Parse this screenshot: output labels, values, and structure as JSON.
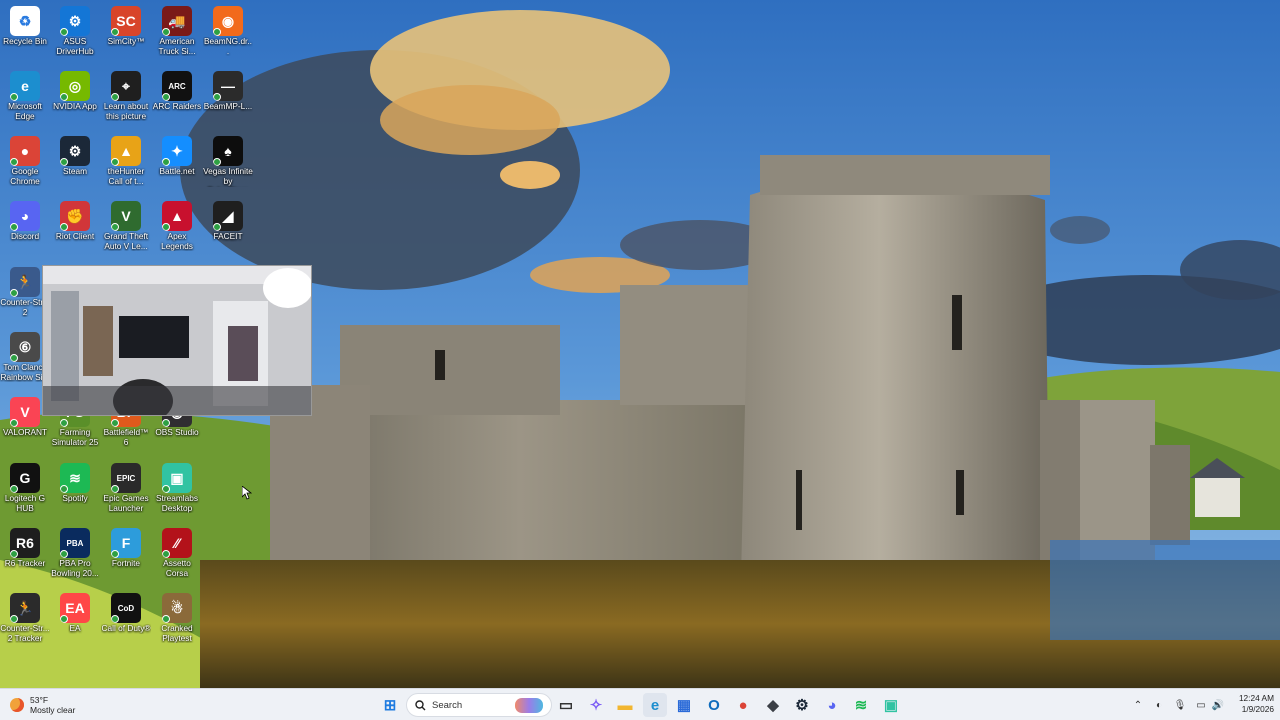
{
  "desktop": {
    "icons": [
      {
        "label": "Recycle Bin",
        "icon": "recycle-bin-icon",
        "color": "#ffffff",
        "glyph": "♻"
      },
      {
        "label": "ASUS DriverHub",
        "icon": "asus-driverhub-icon",
        "color": "#1476d6",
        "glyph": "⚙"
      },
      {
        "label": "SimCity™",
        "icon": "simcity-icon",
        "color": "#d8452a",
        "glyph": "SC"
      },
      {
        "label": "American Truck Si...",
        "icon": "american-truck-simulator-icon",
        "color": "#7a1a18",
        "glyph": "🚚"
      },
      {
        "label": "BeamNG.dr...",
        "icon": "beamng-icon",
        "color": "#f26a1b",
        "glyph": "◉"
      },
      {
        "label": "Microsoft Edge",
        "icon": "microsoft-edge-icon",
        "color": "#1c8ecf",
        "glyph": "e"
      },
      {
        "label": "NVIDIA App",
        "icon": "nvidia-app-icon",
        "color": "#76b900",
        "glyph": "◎"
      },
      {
        "label": "Learn about this picture",
        "icon": "learn-about-picture-icon",
        "color": "#1f1f1f",
        "glyph": "⌖"
      },
      {
        "label": "ARC Raiders",
        "icon": "arc-raiders-icon",
        "color": "#111111",
        "glyph": "ARC"
      },
      {
        "label": "BeamMP-L...",
        "icon": "beammp-launcher-icon",
        "color": "#2b2b2b",
        "glyph": "—"
      },
      {
        "label": "Google Chrome",
        "icon": "google-chrome-icon",
        "color": "#db4437",
        "glyph": "●"
      },
      {
        "label": "Steam",
        "icon": "steam-icon",
        "color": "#1b2838",
        "glyph": "⚙"
      },
      {
        "label": "theHunter Call of t...",
        "icon": "thehunter-icon",
        "color": "#e8a317",
        "glyph": "▲"
      },
      {
        "label": "Battle.net",
        "icon": "battle-net-icon",
        "color": "#148eff",
        "glyph": "✦"
      },
      {
        "label": "Vegas Infinite by PokerStars",
        "icon": "vegas-infinite-icon",
        "color": "#0d0d0d",
        "glyph": "♠"
      },
      {
        "label": "Discord",
        "icon": "discord-icon",
        "color": "#5865f2",
        "glyph": "◕"
      },
      {
        "label": "Riot Client",
        "icon": "riot-client-icon",
        "color": "#d13639",
        "glyph": "✊"
      },
      {
        "label": "Grand Theft Auto V Le...",
        "icon": "gta-v-icon",
        "color": "#2f6b2f",
        "glyph": "V"
      },
      {
        "label": "Apex Legends",
        "icon": "apex-legends-icon",
        "color": "#c8102e",
        "glyph": "▲"
      },
      {
        "label": "FACEIT",
        "icon": "faceit-icon",
        "color": "#1f1f1f",
        "glyph": "◢"
      },
      {
        "label": "Counter-Str... 2",
        "icon": "counter-strike-2-icon",
        "color": "#3a5a8c",
        "glyph": "🏃"
      },
      {
        "label": "Tom Clancy Rainbow Si...",
        "icon": "rainbow-six-siege-icon",
        "color": "#4a4a4a",
        "glyph": "⑥"
      },
      {
        "label": "VALORANT",
        "icon": "valorant-icon",
        "color": "#fa4454",
        "glyph": "V"
      },
      {
        "label": "Farming Simulator 25",
        "icon": "farming-simulator-icon",
        "color": "#5a8f29",
        "glyph": "FS"
      },
      {
        "label": "Battlefield™ 6",
        "icon": "battlefield-6-icon",
        "color": "#e05a1c",
        "glyph": "BF"
      },
      {
        "label": "OBS Studio",
        "icon": "obs-studio-icon",
        "color": "#302e31",
        "glyph": "◉"
      },
      {
        "label": "Logitech G HUB",
        "icon": "logitech-g-hub-icon",
        "color": "#111111",
        "glyph": "G"
      },
      {
        "label": "Spotify",
        "icon": "spotify-icon",
        "color": "#1db954",
        "glyph": "≋"
      },
      {
        "label": "Epic Games Launcher",
        "icon": "epic-games-launcher-icon",
        "color": "#2a2a2a",
        "glyph": "EPIC"
      },
      {
        "label": "Streamlabs Desktop",
        "icon": "streamlabs-desktop-icon",
        "color": "#31c3a2",
        "glyph": "▣"
      },
      {
        "label": "R6 Tracker",
        "icon": "r6-tracker-icon",
        "color": "#1e1e1e",
        "glyph": "R6"
      },
      {
        "label": "PBA Pro Bowling 20...",
        "icon": "pba-pro-bowling-icon",
        "color": "#0a2b5e",
        "glyph": "PBA"
      },
      {
        "label": "Fortnite",
        "icon": "fortnite-icon",
        "color": "#2d9cdb",
        "glyph": "F"
      },
      {
        "label": "Assetto Corsa",
        "icon": "assetto-corsa-icon",
        "color": "#b3121a",
        "glyph": "⁄⁄"
      },
      {
        "label": "Counter-Str... 2 Tracker",
        "icon": "counter-strike-2-tracker-icon",
        "color": "#2b2b2b",
        "glyph": "🏃"
      },
      {
        "label": "EA",
        "icon": "ea-icon",
        "color": "#ff4747",
        "glyph": "EA"
      },
      {
        "label": "Call of Duty®",
        "icon": "call-of-duty-icon",
        "color": "#111111",
        "glyph": "CoD"
      },
      {
        "label": "Cranked Playtest",
        "icon": "cranked-playtest-icon",
        "color": "#8b6a3a",
        "glyph": "☃"
      }
    ]
  },
  "taskbar": {
    "weather": {
      "temp": "53°F",
      "condition": "Mostly clear"
    },
    "search_placeholder": "Search",
    "clock": {
      "time": "12:24 AM",
      "date": "1/9/2026"
    },
    "apps": [
      {
        "name": "start-button",
        "glyph": "⊞",
        "color": "#1e7be0"
      },
      {
        "name": "task-view-button",
        "glyph": "▭",
        "color": "#333333"
      },
      {
        "name": "copilot-button",
        "glyph": "✧",
        "color": "#7b5cf5"
      },
      {
        "name": "file-explorer-button",
        "glyph": "▬",
        "color": "#f2b630"
      },
      {
        "name": "edge-taskbar-button",
        "glyph": "e",
        "color": "#1c8ecf"
      },
      {
        "name": "store-button",
        "glyph": "▦",
        "color": "#2a6ad8"
      },
      {
        "name": "outlook-button",
        "glyph": "O",
        "color": "#0f6cbd"
      },
      {
        "name": "chrome-taskbar-button",
        "glyph": "●",
        "color": "#db4437"
      },
      {
        "name": "app-cube-button",
        "glyph": "◆",
        "color": "#3b3f46"
      },
      {
        "name": "steam-taskbar-button",
        "glyph": "⚙",
        "color": "#1b2838"
      },
      {
        "name": "discord-taskbar-button",
        "glyph": "◕",
        "color": "#5865f2"
      },
      {
        "name": "spotify-taskbar-button",
        "glyph": "≋",
        "color": "#1db954"
      },
      {
        "name": "streamlabs-taskbar-button",
        "glyph": "▣",
        "color": "#31c3a2"
      }
    ],
    "tray": [
      {
        "name": "tray-overflow-icon",
        "glyph": "⌃"
      },
      {
        "name": "tray-security-icon",
        "glyph": "◐"
      },
      {
        "name": "tray-microphone-icon",
        "glyph": "🎙"
      },
      {
        "name": "tray-network-icon",
        "glyph": "▭"
      },
      {
        "name": "tray-volume-icon",
        "glyph": "🔊"
      }
    ]
  }
}
